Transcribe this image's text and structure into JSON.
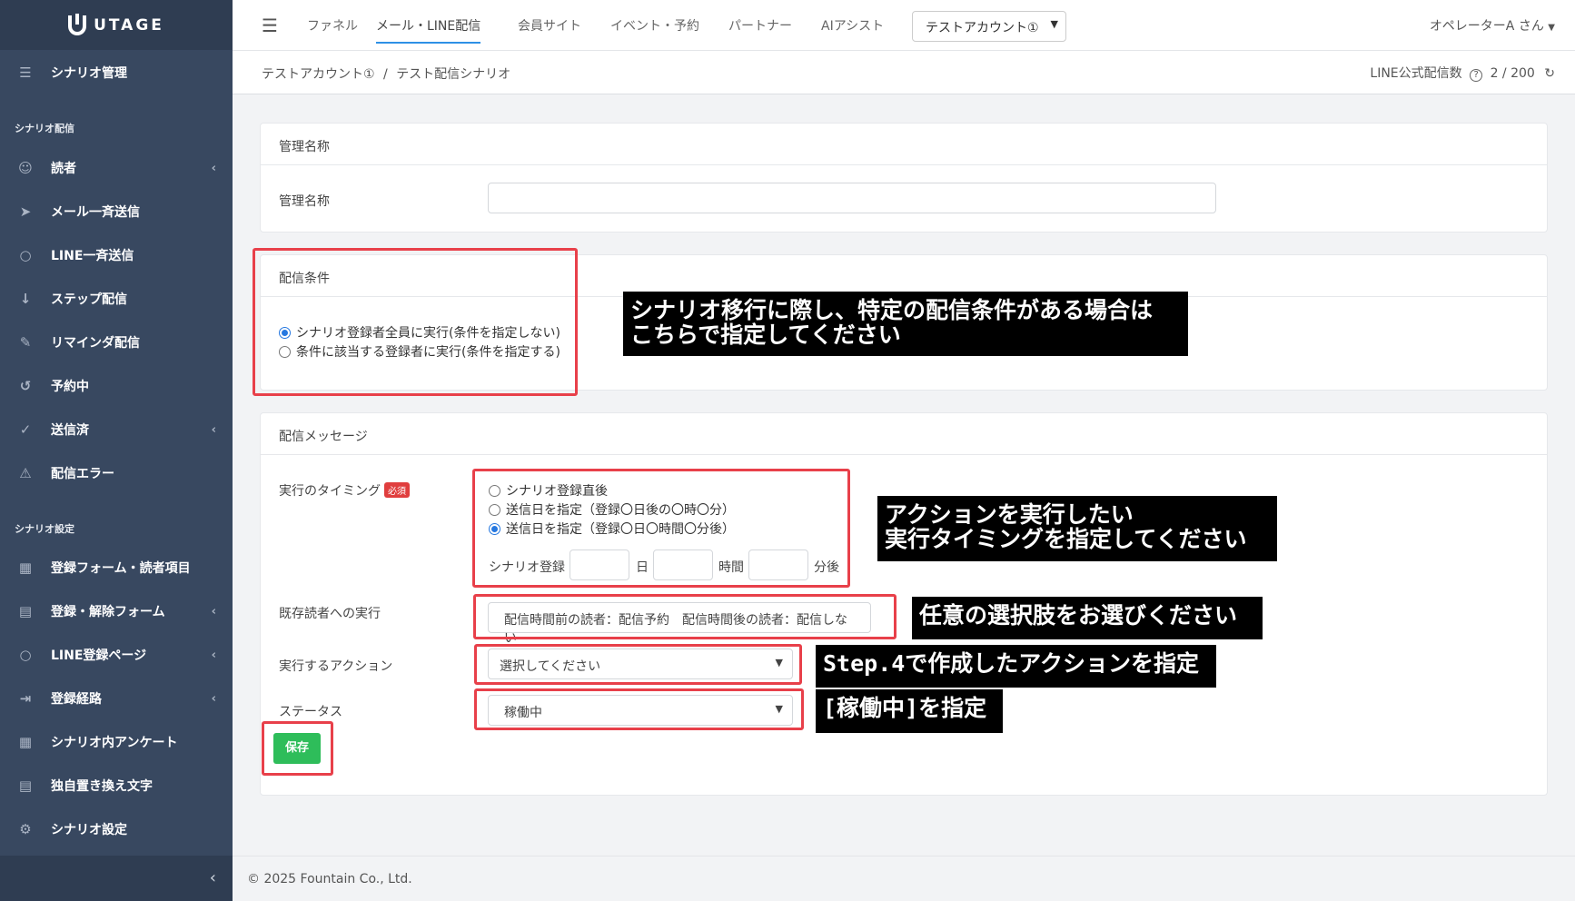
{
  "app": {
    "logo": "UTAGE"
  },
  "sidebar": {
    "top_item": {
      "label": "シナリオ管理",
      "icon": "list-icon"
    },
    "section1": "シナリオ配信",
    "section2": "シナリオ設定",
    "items": [
      {
        "label": "読者",
        "icon": "user-icon",
        "chevron": true
      },
      {
        "label": "メール一斉送信",
        "icon": "send-icon",
        "chevron": false
      },
      {
        "label": "LINE一斉送信",
        "icon": "chat-icon",
        "chevron": false
      },
      {
        "label": "ステップ配信",
        "icon": "sort-icon",
        "chevron": false
      },
      {
        "label": "リマインダ配信",
        "icon": "pencil-icon",
        "chevron": false
      },
      {
        "label": "予約中",
        "icon": "history-icon",
        "chevron": false
      },
      {
        "label": "送信済",
        "icon": "check-icon",
        "chevron": true
      },
      {
        "label": "配信エラー",
        "icon": "warning-icon",
        "chevron": false
      }
    ],
    "items2": [
      {
        "label": "登録フォーム・読者項目",
        "icon": "table-icon",
        "chevron": false
      },
      {
        "label": "登録・解除フォーム",
        "icon": "form-icon",
        "chevron": true
      },
      {
        "label": "LINE登録ページ",
        "icon": "chat-icon",
        "chevron": true
      },
      {
        "label": "登録経路",
        "icon": "route-icon",
        "chevron": true
      },
      {
        "label": "シナリオ内アンケート",
        "icon": "table-icon",
        "chevron": false
      },
      {
        "label": "独自置き換え文字",
        "icon": "doc-icon",
        "chevron": false
      },
      {
        "label": "シナリオ設定",
        "icon": "gear-icon",
        "chevron": false
      }
    ]
  },
  "topnav": {
    "tabs": [
      "ファネル",
      "メール・LINE配信",
      "会員サイト",
      "イベント・予約",
      "パートナー",
      "AIアシスト"
    ],
    "account": "テストアカウント①",
    "operator": "オペレーターA さん"
  },
  "breadcrumb": {
    "account": "テストアカウント①",
    "separator": "/",
    "page": "テスト配信シナリオ",
    "line_count_label": "LINE公式配信数",
    "line_count_value": "2 / 200"
  },
  "card_name": {
    "header": "管理名称",
    "label": "管理名称",
    "value": ""
  },
  "card_condition": {
    "header": "配信条件",
    "options": [
      {
        "label": "シナリオ登録者全員に実行(条件を指定しない)",
        "checked": true
      },
      {
        "label": "条件に該当する登録者に実行(条件を指定する)",
        "checked": false
      }
    ]
  },
  "card_message": {
    "header": "配信メッセージ",
    "timing_label": "実行のタイミング",
    "required": "必須",
    "timing_options": [
      {
        "label": "シナリオ登録直後",
        "checked": false
      },
      {
        "label": "送信日を指定（登録〇日後の〇時〇分）",
        "checked": false
      },
      {
        "label": "送信日を指定（登録〇日〇時間〇分後）",
        "checked": true
      }
    ],
    "offset_prefix": "シナリオ登録",
    "unit_day": "日",
    "unit_hour": "時間",
    "unit_minute": "分後",
    "existing_label": "既存読者への実行",
    "existing_value": "配信時間前の読者：配信予約　配信時間後の読者：配信しない",
    "action_label": "実行するアクション",
    "action_value": "選択してください",
    "status_label": "ステータス",
    "status_value": "稼働中",
    "save_button": "保存"
  },
  "annotations": {
    "condition": "シナリオ移行に際し、特定の配信条件がある場合は\nこちらで指定してください",
    "timing": "アクションを実行したい\n実行タイミングを指定してください",
    "existing": "任意の選択肢をお選びください",
    "action": "Step.4で作成したアクションを指定",
    "status": "[稼働中]を指定",
    "highlight_color": "#e8404a"
  },
  "footer": {
    "copyright": "© 2025 Fountain Co., Ltd."
  }
}
